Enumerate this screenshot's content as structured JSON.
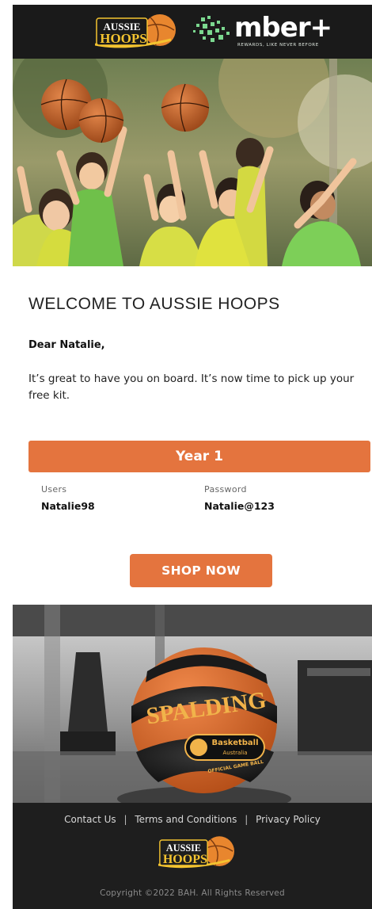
{
  "header": {
    "brand_logo_text": [
      "AUSSIE",
      "HOOPS"
    ],
    "partner_name": "mber+",
    "partner_tagline": "REWARDS, LIKE NEVER BEFORE"
  },
  "welcome": {
    "title": "WELCOME TO AUSSIE HOOPS",
    "greeting": "Dear Natalie,",
    "message": "It’s great to have you on board. It’s now time to pick up your free kit."
  },
  "account": {
    "year_label": "Year 1",
    "users_label": "Users",
    "users_value": "Natalie98",
    "password_label": "Password",
    "password_value": "Natalie@123"
  },
  "cta": {
    "shop_label": "SHOP NOW"
  },
  "ball": {
    "brand": "SPALDING",
    "badge": [
      "Basketball",
      "Australia"
    ],
    "band": "OFFICIAL GAME BALL"
  },
  "footer": {
    "links": [
      "Contact Us",
      "Terms and Conditions",
      "Privacy Policy"
    ],
    "separator": "|",
    "copyright": "Copyright ©2022 BAH. All Rights Reserved"
  },
  "colors": {
    "accent": "#e4743e",
    "dark": "#1a1a1a",
    "ember_green": "#7bd88f"
  }
}
